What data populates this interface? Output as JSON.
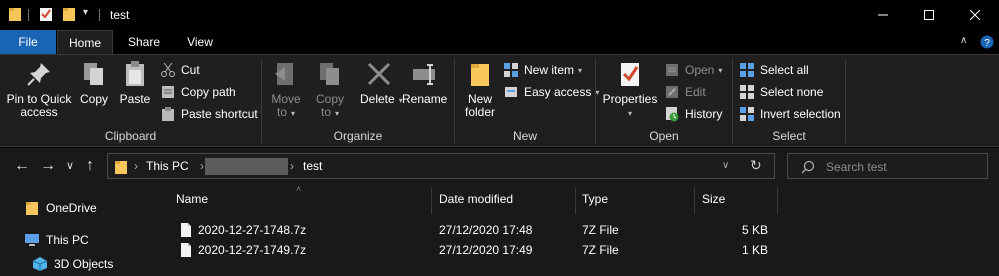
{
  "window": {
    "title": "test",
    "controls": [
      "minimize",
      "maximize",
      "close"
    ]
  },
  "ribbon_tabs": [
    {
      "label": "File"
    },
    {
      "label": "Home"
    },
    {
      "label": "Share"
    },
    {
      "label": "View"
    }
  ],
  "ribbon": {
    "clipboard": {
      "label": "Clipboard",
      "pin_label_1": "Pin to Quick",
      "pin_label_2": "access",
      "copy": "Copy",
      "paste": "Paste",
      "cut": "Cut",
      "copy_path": "Copy path",
      "paste_shortcut": "Paste shortcut"
    },
    "organize": {
      "label": "Organize",
      "move_to_1": "Move",
      "move_to_2": "to",
      "copy_to_1": "Copy",
      "copy_to_2": "to",
      "delete": "Delete",
      "rename": "Rename"
    },
    "new": {
      "label": "New",
      "new_folder_1": "New",
      "new_folder_2": "folder",
      "new_item": "New item",
      "easy_access": "Easy access"
    },
    "open": {
      "label": "Open",
      "properties": "Properties",
      "open": "Open",
      "edit": "Edit",
      "history": "History"
    },
    "select": {
      "label": "Select",
      "select_all": "Select all",
      "select_none": "Select none",
      "invert_selection": "Invert selection"
    }
  },
  "address": {
    "crumb_root": "This PC",
    "crumb_current": "test",
    "search_placeholder": "Search test"
  },
  "navigation": [
    {
      "label": "OneDrive",
      "icon": "folder-icon"
    },
    {
      "label": "This PC",
      "icon": "computer-icon"
    },
    {
      "label": "3D Objects",
      "icon": "cube-icon"
    }
  ],
  "columns": [
    "Name",
    "Date modified",
    "Type",
    "Size"
  ],
  "files": [
    {
      "name": "2020-12-27-1748.7z",
      "date": "27/12/2020 17:48",
      "type": "7Z File",
      "size": "5 KB"
    },
    {
      "name": "2020-12-27-1749.7z",
      "date": "27/12/2020 17:49",
      "type": "7Z File",
      "size": "1 KB"
    }
  ],
  "colors": {
    "accent": "#1a64b4",
    "folder": "#f7c75b",
    "background": "#191919",
    "ribbon": "#1f1f1f"
  }
}
